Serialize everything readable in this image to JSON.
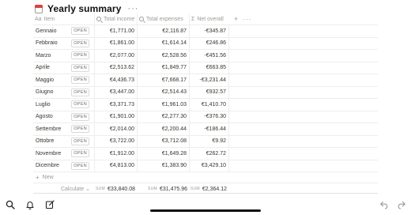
{
  "page": {
    "title": "Yearly summary",
    "title_icon": "calendar-icon",
    "more_label": "···"
  },
  "columns": {
    "item": "Item",
    "item_icon_label": "Aa",
    "income": "Total income",
    "expenses": "Total expenses",
    "net": "Net overall",
    "net_icon_label": "Σ",
    "add_label": "+",
    "more_label": "···"
  },
  "open_label": "OPEN",
  "rows": [
    {
      "item": "Gennaio",
      "income": "€1,771.00",
      "expenses": "€2,116.87",
      "net": "-€345.87"
    },
    {
      "item": "Febbraio",
      "income": "€1,861.00",
      "expenses": "€1,614.14",
      "net": "€246.86"
    },
    {
      "item": "Marzo",
      "income": "€2,077.00",
      "expenses": "€2,528.56",
      "net": "-€451.56"
    },
    {
      "item": "Aprile",
      "income": "€2,513.62",
      "expenses": "€1,849.77",
      "net": "€663.85"
    },
    {
      "item": "Maggio",
      "income": "€4,436.73",
      "expenses": "€7,668.17",
      "net": "-€3,231.44"
    },
    {
      "item": "Giugno",
      "income": "€3,447.00",
      "expenses": "€2,514.43",
      "net": "€932.57"
    },
    {
      "item": "Luglio",
      "income": "€3,371.73",
      "expenses": "€1,961.03",
      "net": "€1,410.70"
    },
    {
      "item": "Agosto",
      "income": "€1,901.00",
      "expenses": "€2,277.30",
      "net": "-€376.30"
    },
    {
      "item": "Settembre",
      "income": "€2,014.00",
      "expenses": "€2,200.44",
      "net": "-€186.44"
    },
    {
      "item": "Ottobre",
      "income": "€3,722.00",
      "expenses": "€3,712.08",
      "net": "€9.92"
    },
    {
      "item": "Novembre",
      "income": "€1,912.00",
      "expenses": "€1,649.28",
      "net": "€262.72"
    },
    {
      "item": "Dicembre",
      "income": "€4,813.00",
      "expenses": "€1,383.90",
      "net": "€3,429.10"
    }
  ],
  "new_row": {
    "plus": "+",
    "label": "New"
  },
  "summary": {
    "calculate_label": "Calculate",
    "calculate_chevron": "⌄",
    "sum_label": "SUM",
    "income_total": "€33,840.08",
    "expenses_total": "€31,475.96",
    "net_total": "€2,364.12"
  },
  "bottom_bar": {
    "icons": [
      "search-icon",
      "bell-icon",
      "compose-icon",
      "back-arrow-icon",
      "forward-arrow-icon"
    ]
  }
}
